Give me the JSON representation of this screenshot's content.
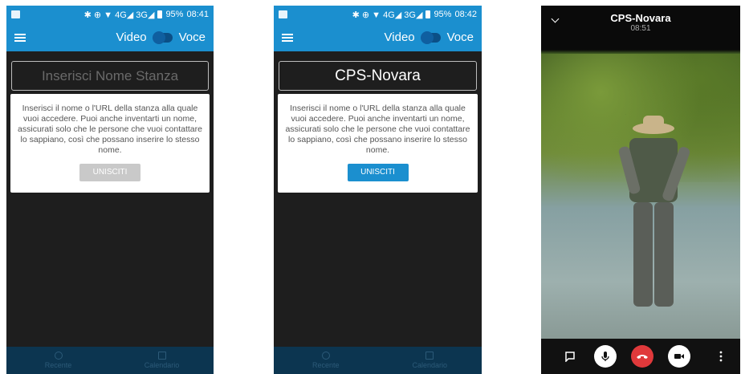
{
  "screen1": {
    "status": {
      "icons": "✱ ⊕ ▼ 4G◢ 3G◢",
      "battery": "95%",
      "time": "08:41"
    },
    "toolbar": {
      "video_label": "Video",
      "voice_label": "Voce"
    },
    "room_placeholder": "Inserisci Nome Stanza",
    "help_text": "Inserisci il nome o l'URL della stanza alla quale vuoi accedere. Puoi anche inventarti un nome, assicurati solo che le persone che vuoi contattare lo sappiano, così che possano inserire lo stesso nome.",
    "join_label": "UNISCITI",
    "nav": {
      "recent": "Recente",
      "calendar": "Calendario"
    }
  },
  "screen2": {
    "status": {
      "icons": "✱ ⊕ ▼ 4G◢ 3G◢",
      "battery": "95%",
      "time": "08:42"
    },
    "toolbar": {
      "video_label": "Video",
      "voice_label": "Voce"
    },
    "room_value": "CPS-Novara",
    "help_text": "Inserisci il nome o l'URL della stanza alla quale vuoi accedere. Puoi anche inventarti un nome, assicurati solo che le persone che vuoi contattare lo sappiano, così che possano inserire lo stesso nome.",
    "join_label": "UNISCITI",
    "nav": {
      "recent": "Recente",
      "calendar": "Calendario"
    }
  },
  "screen3": {
    "title": "CPS-Novara",
    "time": "08:51"
  },
  "colors": {
    "primary": "#1b8fcf",
    "hangup": "#e0393b",
    "dark_bg": "#1e1e1e"
  }
}
